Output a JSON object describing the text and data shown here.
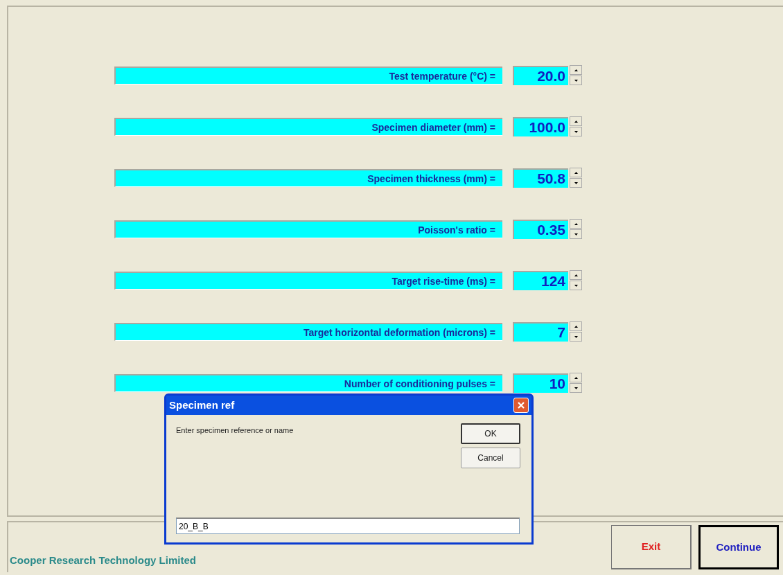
{
  "parameters": [
    {
      "label": "Test temperature (°C) =",
      "value": "20.0"
    },
    {
      "label": "Specimen diameter (mm) =",
      "value": "100.0"
    },
    {
      "label": "Specimen thickness (mm) =",
      "value": "50.8"
    },
    {
      "label": "Poisson's ratio =",
      "value": "0.35"
    },
    {
      "label": "Target rise-time (ms) =",
      "value": "124"
    },
    {
      "label": "Target horizontal deformation (microns) =",
      "value": "7"
    },
    {
      "label": "Number of conditioning pulses =",
      "value": "10"
    }
  ],
  "footer": {
    "company": "Cooper Research Technology Limited",
    "buttons": [
      {
        "label": "Exit",
        "color": "#e02020",
        "default": false
      },
      {
        "label": "Continue",
        "color": "#2020c0",
        "default": true
      }
    ]
  },
  "dialog": {
    "title": "Specimen ref",
    "prompt": "Enter specimen reference or name",
    "buttons": [
      {
        "label": "OK",
        "default": true
      },
      {
        "label": "Cancel",
        "default": false
      }
    ],
    "value": "20_B_B"
  }
}
